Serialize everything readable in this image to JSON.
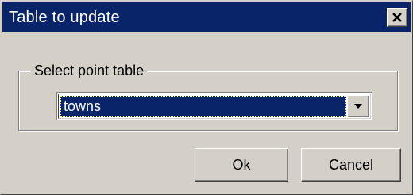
{
  "window": {
    "title": "Table to update",
    "close_icon": "close-icon"
  },
  "group": {
    "label": "Select point table"
  },
  "combo": {
    "selected_value": "towns",
    "arrow_icon": "dropdown-arrow-icon"
  },
  "buttons": {
    "ok_label": "Ok",
    "cancel_label": "Cancel"
  },
  "colors": {
    "titlebar": "#0a246a",
    "face": "#d4d0c8",
    "selection": "#0a246a"
  }
}
